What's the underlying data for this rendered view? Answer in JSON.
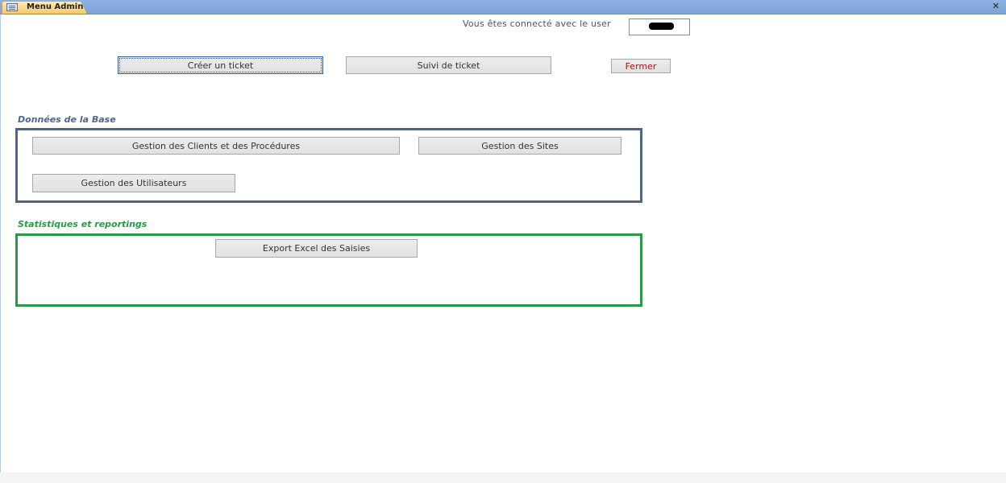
{
  "window": {
    "tab_label": "Menu Admin",
    "close_glyph": "✕"
  },
  "header": {
    "connected_text": "Vous êtes connecté avec le user",
    "user_value_redacted": true
  },
  "top_buttons": {
    "create_ticket": "Créer un ticket",
    "follow_ticket": "Suivi de ticket",
    "close": "Fermer"
  },
  "database_section": {
    "title": "Données de la Base",
    "buttons": {
      "clients": "Gestion des Clients et des Procédures",
      "sites": "Gestion des Sites",
      "users": "Gestion des Utilisateurs"
    }
  },
  "stats_section": {
    "title": "Statistiques et reportings",
    "buttons": {
      "export": "Export Excel des Saisies"
    }
  },
  "colors": {
    "database_accent": "#4e6688",
    "stats_accent": "#2a9a47",
    "close_text": "#b31313"
  }
}
